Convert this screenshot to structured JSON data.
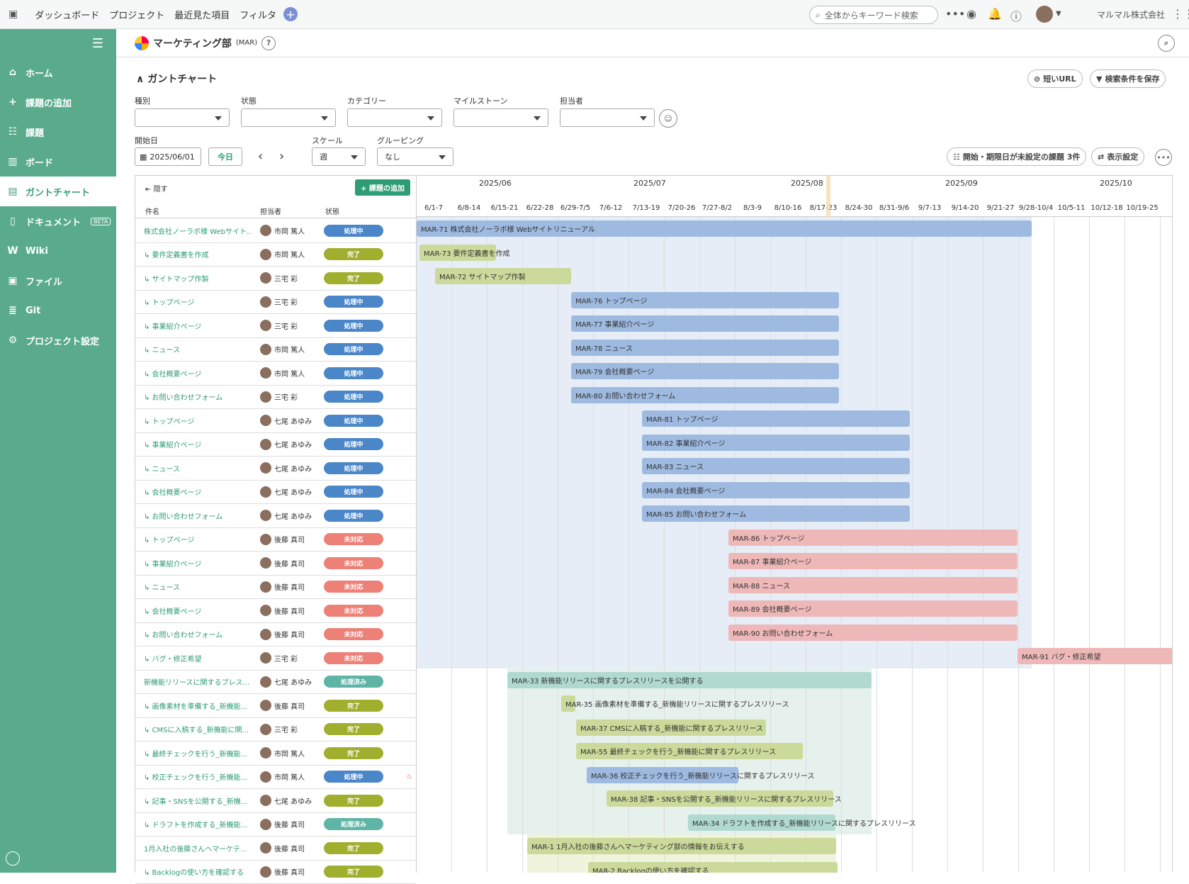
{
  "topnav": {
    "logo_icon": "backlog-logo-icon",
    "items": [
      "ダッシュボード",
      "プロジェクト",
      "最近見た項目",
      "フィルタ"
    ],
    "search_placeholder": "全体からキーワード検索",
    "company": "マルマル株式会社"
  },
  "sidebar": {
    "items": [
      {
        "label": "ホーム",
        "icon": "home-icon"
      },
      {
        "label": "課題の追加",
        "icon": "plus-icon"
      },
      {
        "label": "課題",
        "icon": "list-icon"
      },
      {
        "label": "ボード",
        "icon": "board-icon"
      },
      {
        "label": "ガントチャート",
        "icon": "gantt-icon"
      },
      {
        "label": "ドキュメント",
        "icon": "document-icon",
        "badge": "BETA"
      },
      {
        "label": "Wiki",
        "icon": "wiki-icon"
      },
      {
        "label": "ファイル",
        "icon": "file-icon"
      },
      {
        "label": "Git",
        "icon": "git-icon"
      },
      {
        "label": "プロジェクト設定",
        "icon": "gear-icon"
      }
    ]
  },
  "project": {
    "name": "マーケティング部",
    "key": "(MAR)"
  },
  "gantt": {
    "title": "ガントチャート",
    "short_url": "短いURL",
    "save_search": "検索条件を保存",
    "filters": {
      "type_label": "種別",
      "status_label": "状態",
      "category_label": "カテゴリー",
      "milestone_label": "マイルストーン",
      "assignee_label": "担当者",
      "start_label": "開始日",
      "start_value": "2025/06/01",
      "today": "今日",
      "scale_label": "スケール",
      "scale_value": "週",
      "grouping_label": "グルーピング",
      "grouping_value": "なし"
    },
    "unset_issues": "開始・期限日が未設定の課題 3件",
    "display_settings": "表示設定",
    "hide": "隠す",
    "add_issue": "課題の追加",
    "col_name": "件名",
    "col_assignee": "担当者",
    "col_status": "状態",
    "months": [
      "2025/06",
      "2025/07",
      "2025/08",
      "2025/09",
      "2025/10"
    ],
    "weeks": [
      "6/1-7",
      "6/8-14",
      "6/15-21",
      "6/22-28",
      "6/29-7/5",
      "7/6-12",
      "7/13-19",
      "7/20-26",
      "7/27-8/2",
      "8/3-9",
      "8/10-16",
      "8/17-23",
      "8/24-30",
      "8/31-9/6",
      "9/7-13",
      "9/14-20",
      "9/21-27",
      "9/28-10/4",
      "10/5-11",
      "10/12-18",
      "10/19-25",
      "10/"
    ]
  },
  "status_colors": {
    "処理中": "#4a86c8",
    "完了": "#a1af2f",
    "未対応": "#ed8077",
    "処理済み": "#5eb5a6"
  },
  "rows": [
    {
      "name": "株式会社ノーラボ様 Webサイト...",
      "assignee": "市岡 篤人",
      "status": "処理中",
      "bar": "MAR-71  株式会社ノーラボ様 Webサイトリニューアル"
    },
    {
      "name": "↳ 要件定義書を作成",
      "assignee": "市岡 篤人",
      "status": "完了",
      "bar": "MAR-73  要件定義書を作成"
    },
    {
      "name": "↳ サイトマップ作製",
      "assignee": "三宅 彩",
      "status": "完了",
      "bar": "MAR-72  サイトマップ作製"
    },
    {
      "name": "↳ トップページ",
      "assignee": "三宅 彩",
      "status": "処理中",
      "bar": "MAR-76  トップページ"
    },
    {
      "name": "↳ 事業紹介ページ",
      "assignee": "三宅 彩",
      "status": "処理中",
      "bar": "MAR-77  事業紹介ページ"
    },
    {
      "name": "↳ ニュース",
      "assignee": "市岡 篤人",
      "status": "処理中",
      "bar": "MAR-78  ニュース"
    },
    {
      "name": "↳ 会社概要ページ",
      "assignee": "市岡 篤人",
      "status": "処理中",
      "bar": "MAR-79  会社概要ページ"
    },
    {
      "name": "↳ お問い合わせフォーム",
      "assignee": "三宅 彩",
      "status": "処理中",
      "bar": "MAR-80  お問い合わせフォーム"
    },
    {
      "name": "↳ トップページ",
      "assignee": "七尾 あゆみ",
      "status": "処理中",
      "bar": "MAR-81  トップページ"
    },
    {
      "name": "↳ 事業紹介ページ",
      "assignee": "七尾 あゆみ",
      "status": "処理中",
      "bar": "MAR-82  事業紹介ページ"
    },
    {
      "name": "↳ ニュース",
      "assignee": "七尾 あゆみ",
      "status": "処理中",
      "bar": "MAR-83  ニュース"
    },
    {
      "name": "↳ 会社概要ページ",
      "assignee": "七尾 あゆみ",
      "status": "処理中",
      "bar": "MAR-84  会社概要ページ"
    },
    {
      "name": "↳ お問い合わせフォーム",
      "assignee": "七尾 あゆみ",
      "status": "処理中",
      "bar": "MAR-85  お問い合わせフォーム"
    },
    {
      "name": "↳ トップページ",
      "assignee": "後藤 真司",
      "status": "未対応",
      "bar": "MAR-86  トップページ"
    },
    {
      "name": "↳ 事業紹介ページ",
      "assignee": "後藤 真司",
      "status": "未対応",
      "bar": "MAR-87  事業紹介ページ"
    },
    {
      "name": "↳ ニュース",
      "assignee": "後藤 真司",
      "status": "未対応",
      "bar": "MAR-88  ニュース"
    },
    {
      "name": "↳ 会社概要ページ",
      "assignee": "後藤 真司",
      "status": "未対応",
      "bar": "MAR-89  会社概要ページ"
    },
    {
      "name": "↳ お問い合わせフォーム",
      "assignee": "後藤 真司",
      "status": "未対応",
      "bar": "MAR-90  お問い合わせフォーム"
    },
    {
      "name": "↳ バグ・修正希望",
      "assignee": "三宅 彩",
      "status": "未対応",
      "bar": "MAR-91  バグ・修正希望"
    },
    {
      "name": "新機能リリースに関するプレス...",
      "assignee": "七尾 あゆみ",
      "status": "処理済み",
      "bar": "MAR-33  新機能リリースに関するプレスリリースを公開する"
    },
    {
      "name": "↳ 画像素材を準備する_新機能...",
      "assignee": "後藤 真司",
      "status": "完了",
      "bar": "MAR-35  画像素材を準備する_新機能リリースに関するプレスリリース"
    },
    {
      "name": "↳ CMSに入稿する_新機能に関...",
      "assignee": "三宅 彩",
      "status": "完了",
      "bar": "MAR-37  CMSに入稿する_新機能に関するプレスリリース"
    },
    {
      "name": "↳ 最終チェックを行う_新機能...",
      "assignee": "市岡 篤人",
      "status": "完了",
      "bar": "MAR-55  最終チェックを行う_新機能に関するプレスリリース"
    },
    {
      "name": "↳ 校正チェックを行う_新機能...",
      "assignee": "市岡 篤人",
      "status": "処理中",
      "bar": "MAR-36  校正チェックを行う_新機能リリースに関するプレスリリース"
    },
    {
      "name": "↳ 記事・SNSを公開する_新機...",
      "assignee": "七尾 あゆみ",
      "status": "完了",
      "bar": "MAR-38  記事・SNSを公開する_新機能リリースに関するプレスリリース"
    },
    {
      "name": "↳ ドラフトを作成する_新機能...",
      "assignee": "後藤 真司",
      "status": "処理済み",
      "bar": "MAR-34  ドラフトを作成する_新機能リリースに関するプレスリリース"
    },
    {
      "name": "1月入社の後藤さんへマーケテ...",
      "assignee": "後藤 真司",
      "status": "完了",
      "bar": "MAR-1  1月入社の後藤さんへマーケティング部の情報をお伝えする"
    },
    {
      "name": "↳ Backlogの使い方を確認する",
      "assignee": "後藤 真司",
      "status": "完了",
      "bar": "MAR-2  Backlogの使い方を確認する"
    }
  ]
}
